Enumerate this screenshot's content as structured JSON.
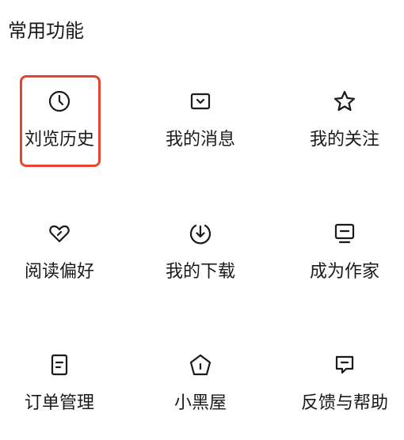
{
  "section": {
    "title": "常用功能"
  },
  "highlight_color": "#e5442f",
  "items": [
    {
      "label": "刘览历史",
      "icon": "clock-icon"
    },
    {
      "label": "我的消息",
      "icon": "message-icon"
    },
    {
      "label": "我的关注",
      "icon": "star-icon"
    },
    {
      "label": "阅读偏好",
      "icon": "heart-icon"
    },
    {
      "label": "我的下载",
      "icon": "download-icon"
    },
    {
      "label": "成为作家",
      "icon": "monitor-icon"
    },
    {
      "label": "订单管理",
      "icon": "document-icon"
    },
    {
      "label": "小黑屋",
      "icon": "house-icon"
    },
    {
      "label": "反馈与帮助",
      "icon": "feedback-icon"
    }
  ]
}
